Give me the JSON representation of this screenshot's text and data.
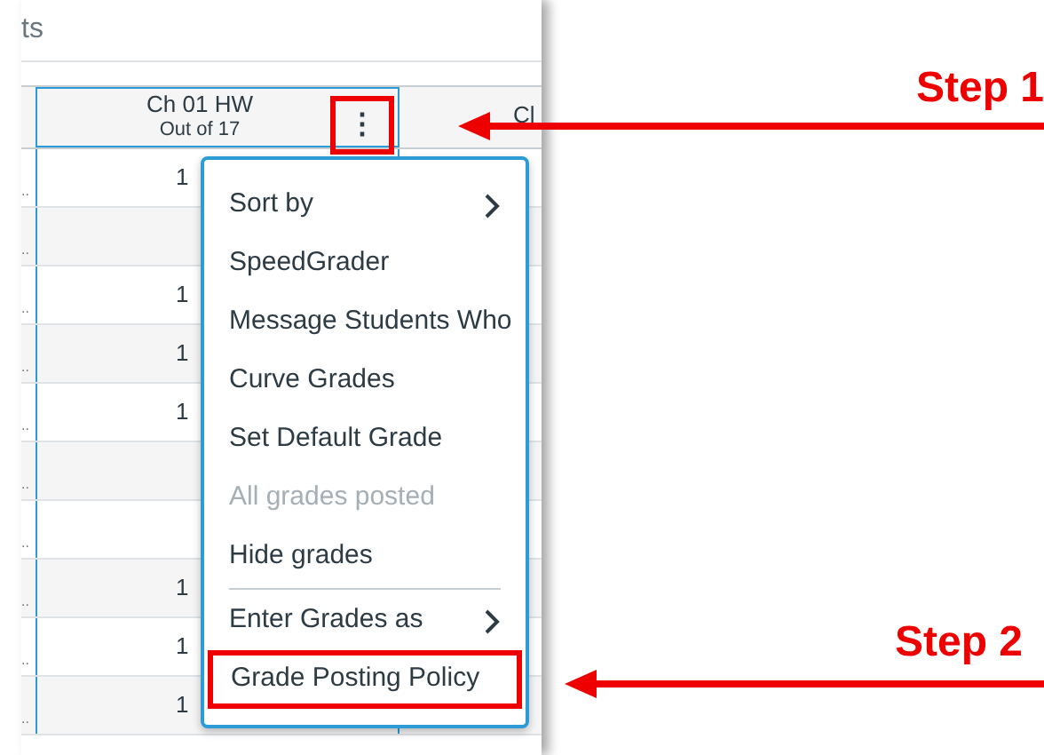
{
  "page_heading": "ts",
  "column_header": {
    "title": "Ch 01 HW",
    "subtitle": "Out of 17",
    "menu_button": {
      "label": "⋮",
      "highlighted": true
    }
  },
  "next_column_header": {
    "title": "Cl"
  },
  "rows": [
    {
      "student": "..",
      "score": "1"
    },
    {
      "student": ".."
    },
    {
      "student": "..",
      "score": "1"
    },
    {
      "student": "..",
      "score": "1"
    },
    {
      "student": "..",
      "score": "1"
    },
    {
      "student": ".."
    },
    {
      "student": ".."
    },
    {
      "student": "..",
      "score": "1"
    },
    {
      "student": "..",
      "score": "1"
    },
    {
      "student": "..",
      "score": "1"
    }
  ],
  "menu": {
    "items": [
      {
        "label": "Sort by",
        "kind": "submenu",
        "disabled": false,
        "highlighted": false
      },
      {
        "label": "SpeedGrader",
        "kind": "action",
        "disabled": false,
        "highlighted": false
      },
      {
        "label": "Message Students Who",
        "kind": "action",
        "disabled": false,
        "highlighted": false
      },
      {
        "label": "Curve Grades",
        "kind": "action",
        "disabled": false,
        "highlighted": false
      },
      {
        "label": "Set Default Grade",
        "kind": "action",
        "disabled": false,
        "highlighted": false
      },
      {
        "label": "All grades posted",
        "kind": "action",
        "disabled": true,
        "highlighted": false
      },
      {
        "label": "Hide grades",
        "kind": "action",
        "disabled": false,
        "highlighted": false
      },
      {
        "kind": "divider"
      },
      {
        "label": "Enter Grades as",
        "kind": "submenu",
        "disabled": false,
        "highlighted": false
      },
      {
        "label": "Grade Posting Policy",
        "kind": "action",
        "disabled": false,
        "highlighted": true
      }
    ]
  },
  "annotations": [
    {
      "label": "Step 1"
    },
    {
      "label": "Step 2"
    }
  ]
}
